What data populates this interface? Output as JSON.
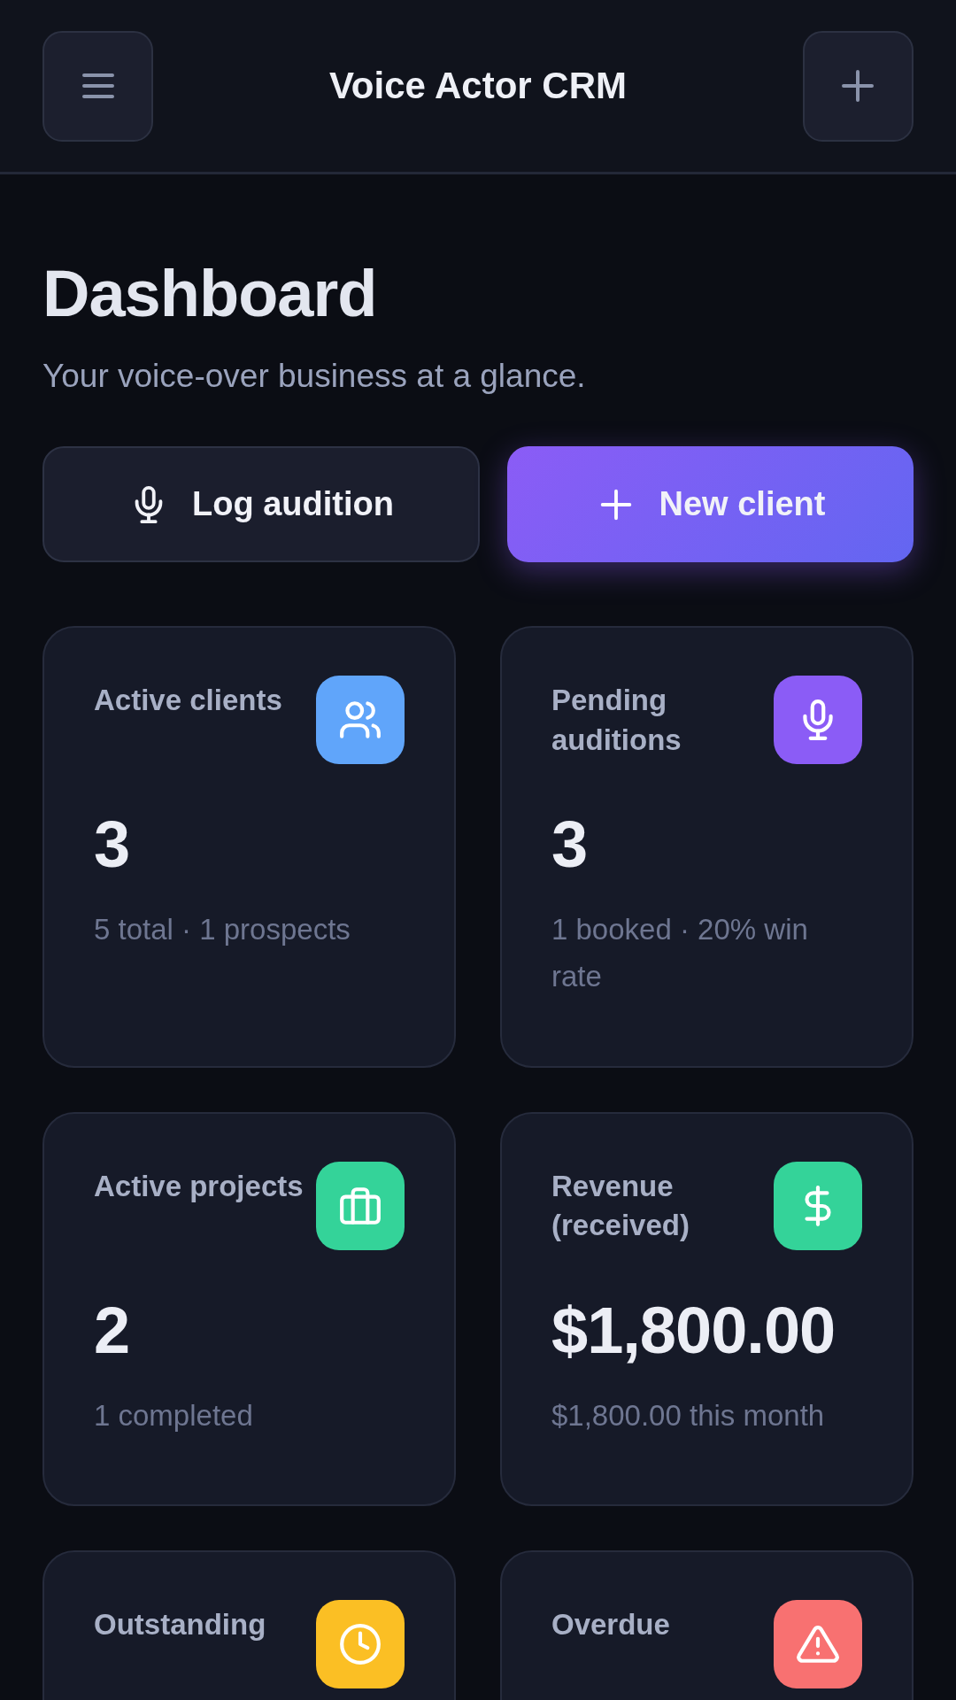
{
  "header": {
    "title": "Voice Actor CRM"
  },
  "page": {
    "title": "Dashboard",
    "subtitle": "Your voice-over business at a glance."
  },
  "actions": [
    {
      "label": "Log audition",
      "kind": "secondary"
    },
    {
      "label": "New client",
      "kind": "primary"
    }
  ],
  "stats": [
    {
      "label": "Active clients",
      "value": "3",
      "detail": "5 total · 1 prospects",
      "color": "#60a5fa"
    },
    {
      "label": "Pending auditions",
      "value": "3",
      "detail": "1 booked · 20% win rate",
      "color": "#8b5cf6"
    },
    {
      "label": "Active projects",
      "value": "2",
      "detail": "1 completed",
      "color": "#34d399"
    },
    {
      "label": "Revenue (received)",
      "value": "$1,800.00",
      "detail": "$1,800.00 this month",
      "color": "#34d399"
    },
    {
      "label": "Outstanding",
      "color": "#fbbf24"
    },
    {
      "label": "Overdue",
      "color": "#f87171"
    }
  ]
}
